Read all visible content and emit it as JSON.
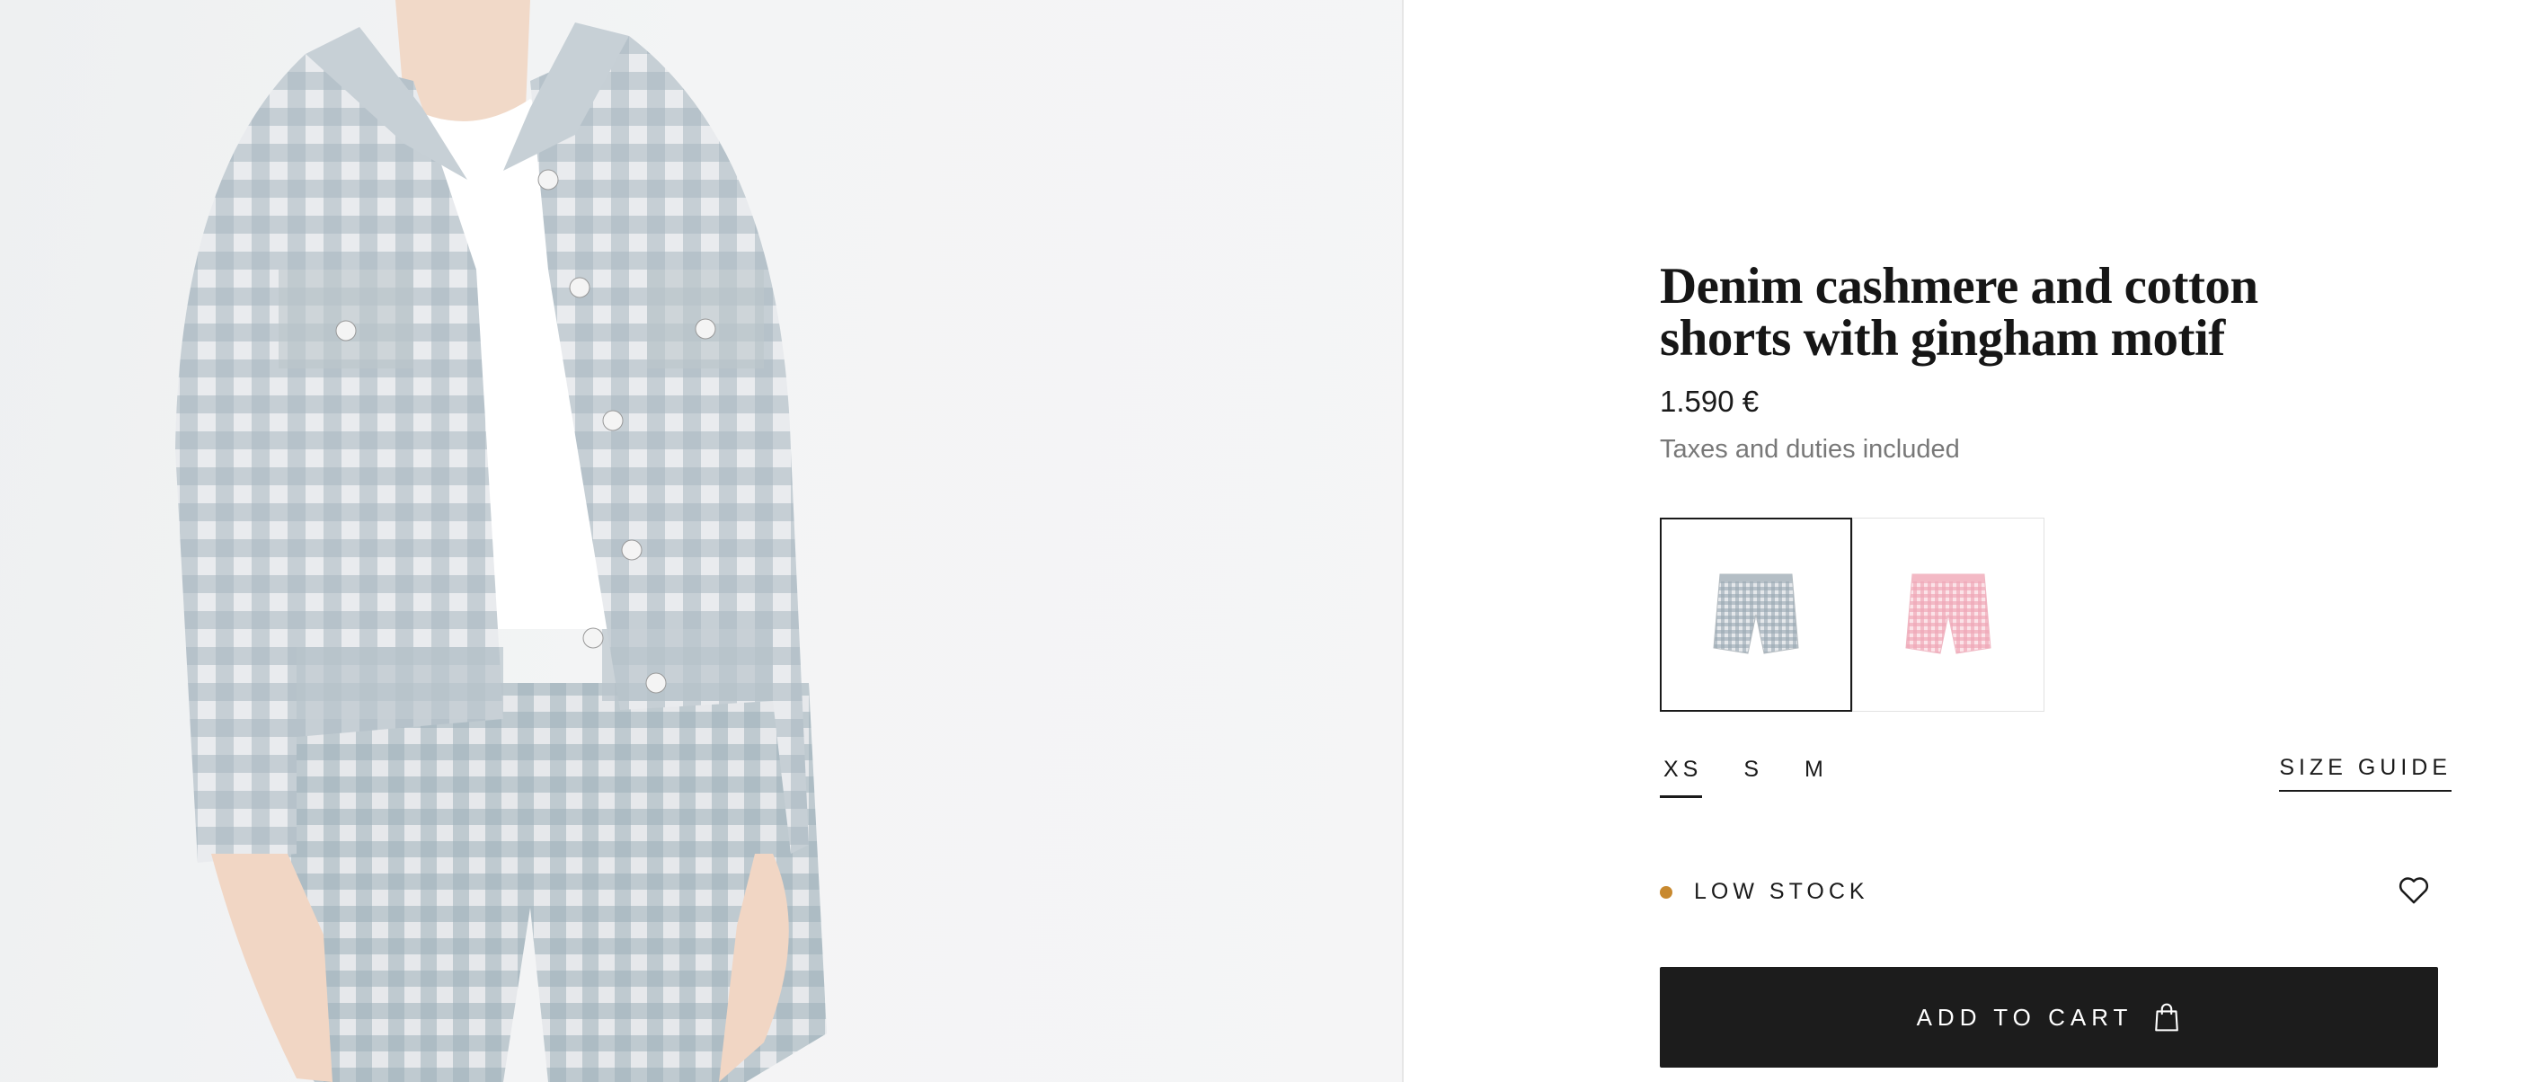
{
  "product": {
    "title": "Denim cashmere and cotton shorts with gingham motif",
    "price": "1.590 €",
    "taxes_note": "Taxes and duties included"
  },
  "variants": [
    {
      "color_name": "denim",
      "color": "#9aa9b3",
      "selected": true
    },
    {
      "color_name": "pink",
      "color": "#f0a9b8",
      "selected": false
    }
  ],
  "sizes": [
    {
      "label": "XS",
      "selected": true
    },
    {
      "label": "S",
      "selected": false
    },
    {
      "label": "M",
      "selected": false
    }
  ],
  "size_guide_label": "SIZE GUIDE",
  "stock": {
    "label": "LOW STOCK",
    "dot_color": "#c8892f"
  },
  "wishlist_icon": "heart-icon",
  "cart": {
    "label": "ADD TO CART",
    "icon": "shopping-bag-icon"
  },
  "colors": {
    "accent": "#1c1c1c",
    "muted_text": "#787878"
  }
}
